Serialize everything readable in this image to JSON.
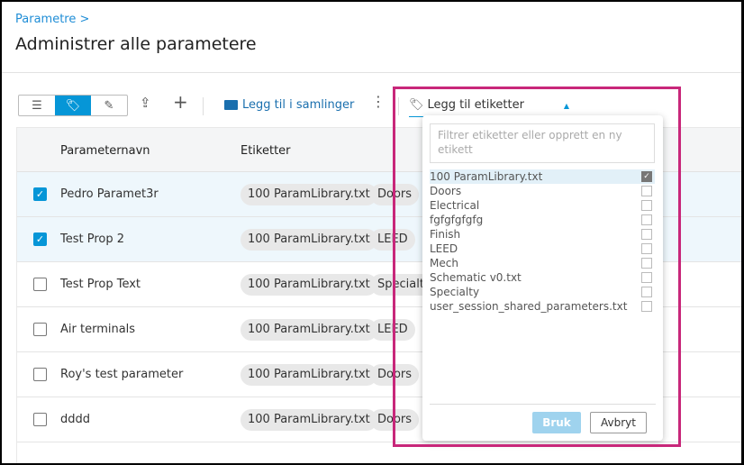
{
  "breadcrumb": "Parametre >",
  "title": "Administrer alle parametere",
  "toolbar": {
    "add_to_collection": "Legg til i samlinger",
    "add_tags": "Legg til etiketter"
  },
  "table": {
    "headers": [
      "Parameternavn",
      "Etiketter"
    ],
    "rows": [
      {
        "name": "Pedro Paramet3r",
        "checked": true,
        "tags": [
          "100 ParamLibrary.txt",
          "Doors"
        ]
      },
      {
        "name": "Test Prop 2",
        "checked": true,
        "tags": [
          "100 ParamLibrary.txt",
          "LEED"
        ]
      },
      {
        "name": "Test Prop Text",
        "checked": false,
        "tags": [
          "100 ParamLibrary.txt",
          "Specialty"
        ]
      },
      {
        "name": "Air terminals",
        "checked": false,
        "tags": [
          "100 ParamLibrary.txt",
          "LEED"
        ]
      },
      {
        "name": "Roy's test parameter",
        "checked": false,
        "tags": [
          "100 ParamLibrary.txt",
          "Doors"
        ]
      },
      {
        "name": "dddd",
        "checked": false,
        "tags": [
          "100 ParamLibrary.txt",
          "Doors"
        ]
      }
    ]
  },
  "dropdown": {
    "placeholder": "Filtrer etiketter eller opprett en ny etikett",
    "items": [
      {
        "label": "100 ParamLibrary.txt",
        "checked": true
      },
      {
        "label": "Doors",
        "checked": false
      },
      {
        "label": "Electrical",
        "checked": false
      },
      {
        "label": "fgfgfgfgfg",
        "checked": false
      },
      {
        "label": "Finish",
        "checked": false
      },
      {
        "label": "LEED",
        "checked": false
      },
      {
        "label": "Mech",
        "checked": false
      },
      {
        "label": "Schematic v0.txt",
        "checked": false
      },
      {
        "label": "Specialty",
        "checked": false
      },
      {
        "label": "user_session_shared_parameters.txt",
        "checked": false
      }
    ],
    "apply": "Bruk",
    "cancel": "Avbryt"
  },
  "colors": {
    "accent": "#0696d7",
    "highlight": "#c8277a"
  }
}
